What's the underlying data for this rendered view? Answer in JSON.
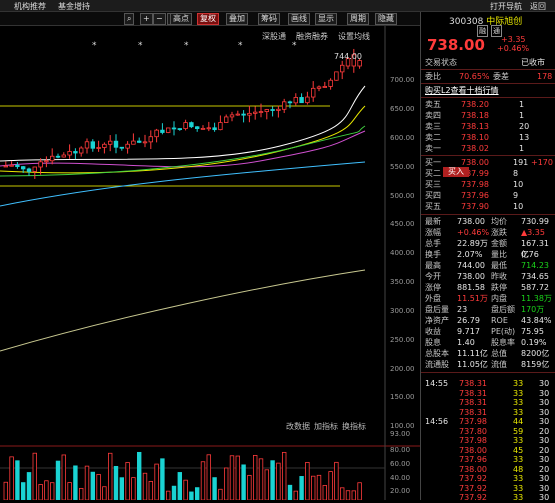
{
  "topbar": {
    "left1": "机构推荐",
    "left2": "基金增持",
    "right1": "打开导航",
    "right2": "返回"
  },
  "toolbar": {
    "items": [
      "",
      "+",
      "−",
      "☐",
      "高点",
      "复权",
      "叠加",
      "筹码",
      "画线",
      "显示",
      "周期",
      "隐藏"
    ],
    "search": "⌕"
  },
  "chart_header": {
    "items": [
      "深股通",
      "融资融券",
      "设置均线"
    ]
  },
  "yaxis": [
    "700.00",
    "650.00",
    "600.00",
    "550.00",
    "500.00",
    "450.00",
    "400.00",
    "350.00",
    "300.00",
    "250.00",
    "200.00",
    "150.00",
    "100.00"
  ],
  "peak_label": "744.00",
  "indicator_tabs": [
    "改数据",
    "加指标",
    "换指标"
  ],
  "vol_axis": [
    "93.00",
    "80.00",
    "60.00",
    "40.00",
    "20.00"
  ],
  "stock": {
    "code": "300308",
    "name": "中际旭创",
    "tags": [
      "融",
      "通"
    ],
    "price": "738.00",
    "change": "+3.35",
    "pct": "+0.46%"
  },
  "status": {
    "label": "交易状态",
    "value": "已收市"
  },
  "ratio": {
    "wb_label": "委比",
    "wb": "70.65%",
    "wc_label": "委差",
    "wc": "178"
  },
  "level2": "购买L2查看十档行情",
  "asks": [
    {
      "label": "卖五",
      "price": "738.20",
      "vol": "1"
    },
    {
      "label": "卖四",
      "price": "738.18",
      "vol": "1"
    },
    {
      "label": "卖三",
      "price": "738.13",
      "vol": "20"
    },
    {
      "label": "卖二",
      "price": "738.10",
      "vol": "13"
    },
    {
      "label": "卖一",
      "price": "738.02",
      "vol": "1"
    }
  ],
  "bids": [
    {
      "label": "买一",
      "price": "738.00",
      "vol": "191",
      "chg": "+170"
    },
    {
      "label": "买二",
      "price": "737.99",
      "vol": "8"
    },
    {
      "label": "买三",
      "price": "737.98",
      "vol": "10"
    },
    {
      "label": "买四",
      "price": "737.96",
      "vol": "9"
    },
    {
      "label": "买五",
      "price": "737.90",
      "vol": "10"
    }
  ],
  "buy_button": "买入",
  "stats": [
    [
      "最新",
      "738.00",
      "均价",
      "730.99"
    ],
    [
      "涨幅",
      "+0.46%",
      "涨跌",
      "▲3.35"
    ],
    [
      "总手",
      "22.89万",
      "金额",
      "167.31亿"
    ],
    [
      "换手",
      "2.07%",
      "量比",
      "0.76"
    ],
    [
      "最高",
      "744.00",
      "最低",
      "714.23"
    ],
    [
      "今开",
      "738.00",
      "昨收",
      "734.65"
    ],
    [
      "涨停",
      "881.58",
      "跌停",
      "587.72"
    ],
    [
      "外盘",
      "11.51万",
      "内盘",
      "11.38万"
    ],
    [
      "盘后量",
      "23",
      "盘后额",
      "170万"
    ],
    [
      "净资产",
      "26.79",
      "ROE",
      "43.84%"
    ],
    [
      "收益",
      "9.717",
      "PE(动)",
      "75.95"
    ],
    [
      "股息",
      "1.40",
      "股息率",
      "0.19%"
    ],
    [
      "总股本",
      "11.11亿",
      "总值",
      "8200亿"
    ],
    [
      "流通股",
      "11.05亿",
      "流值",
      "8159亿"
    ]
  ],
  "ticks": [
    [
      "14:55",
      "738.31",
      "33",
      "30"
    ],
    [
      "",
      "738.31",
      "33",
      "30"
    ],
    [
      "",
      "738.31",
      "33",
      "30"
    ],
    [
      "",
      "738.31",
      "33",
      "30"
    ],
    [
      "14:56",
      "737.98",
      "44",
      "30"
    ],
    [
      "",
      "737.80",
      "59",
      "20"
    ],
    [
      "",
      "737.98",
      "33",
      "30"
    ],
    [
      "",
      "738.00",
      "45",
      "20"
    ],
    [
      "",
      "737.96",
      "33",
      "30"
    ],
    [
      "",
      "738.00",
      "48",
      "20"
    ],
    [
      "",
      "737.92",
      "33",
      "30"
    ],
    [
      "",
      "737.92",
      "33",
      "30"
    ],
    [
      "",
      "737.92",
      "33",
      "30"
    ]
  ],
  "colors": {
    "up": "#ff3b3b",
    "down": "#1ad31a",
    "ma1": "#ffffff",
    "ma2": "#e8e800",
    "ma3": "#d050d0",
    "ma4": "#40d040"
  }
}
